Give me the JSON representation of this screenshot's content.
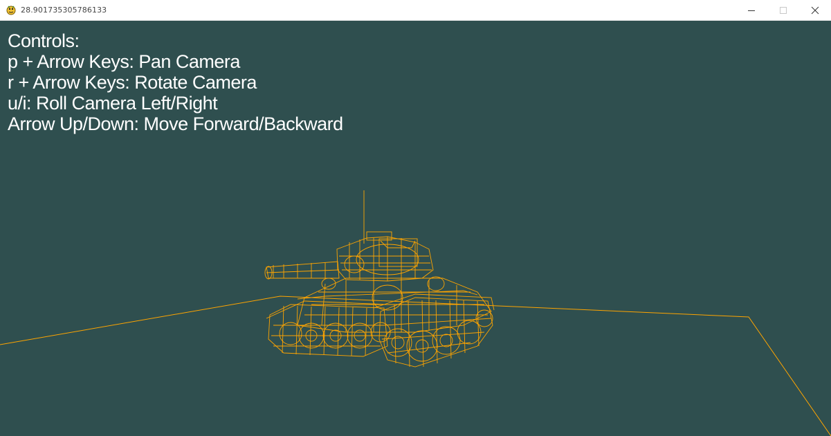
{
  "window": {
    "title": "28.901735305786133",
    "app_icon": "pygame-snake-icon",
    "buttons": {
      "minimize": "minimize-icon",
      "maximize": "maximize-icon",
      "close": "close-icon"
    }
  },
  "overlay": {
    "heading": "Controls:",
    "lines": [
      "p + Arrow Keys: Pan Camera",
      "r + Arrow Keys: Rotate Camera",
      "u/i: Roll Camera Left/Right",
      "Arrow Up/Down: Move Forward/Backward"
    ]
  },
  "colors": {
    "background": "#2f4f4f",
    "wireframe": "#ffa500",
    "text": "#ffffff"
  },
  "scene": {
    "model": "tank wireframe",
    "render_mode": "wireframe"
  }
}
